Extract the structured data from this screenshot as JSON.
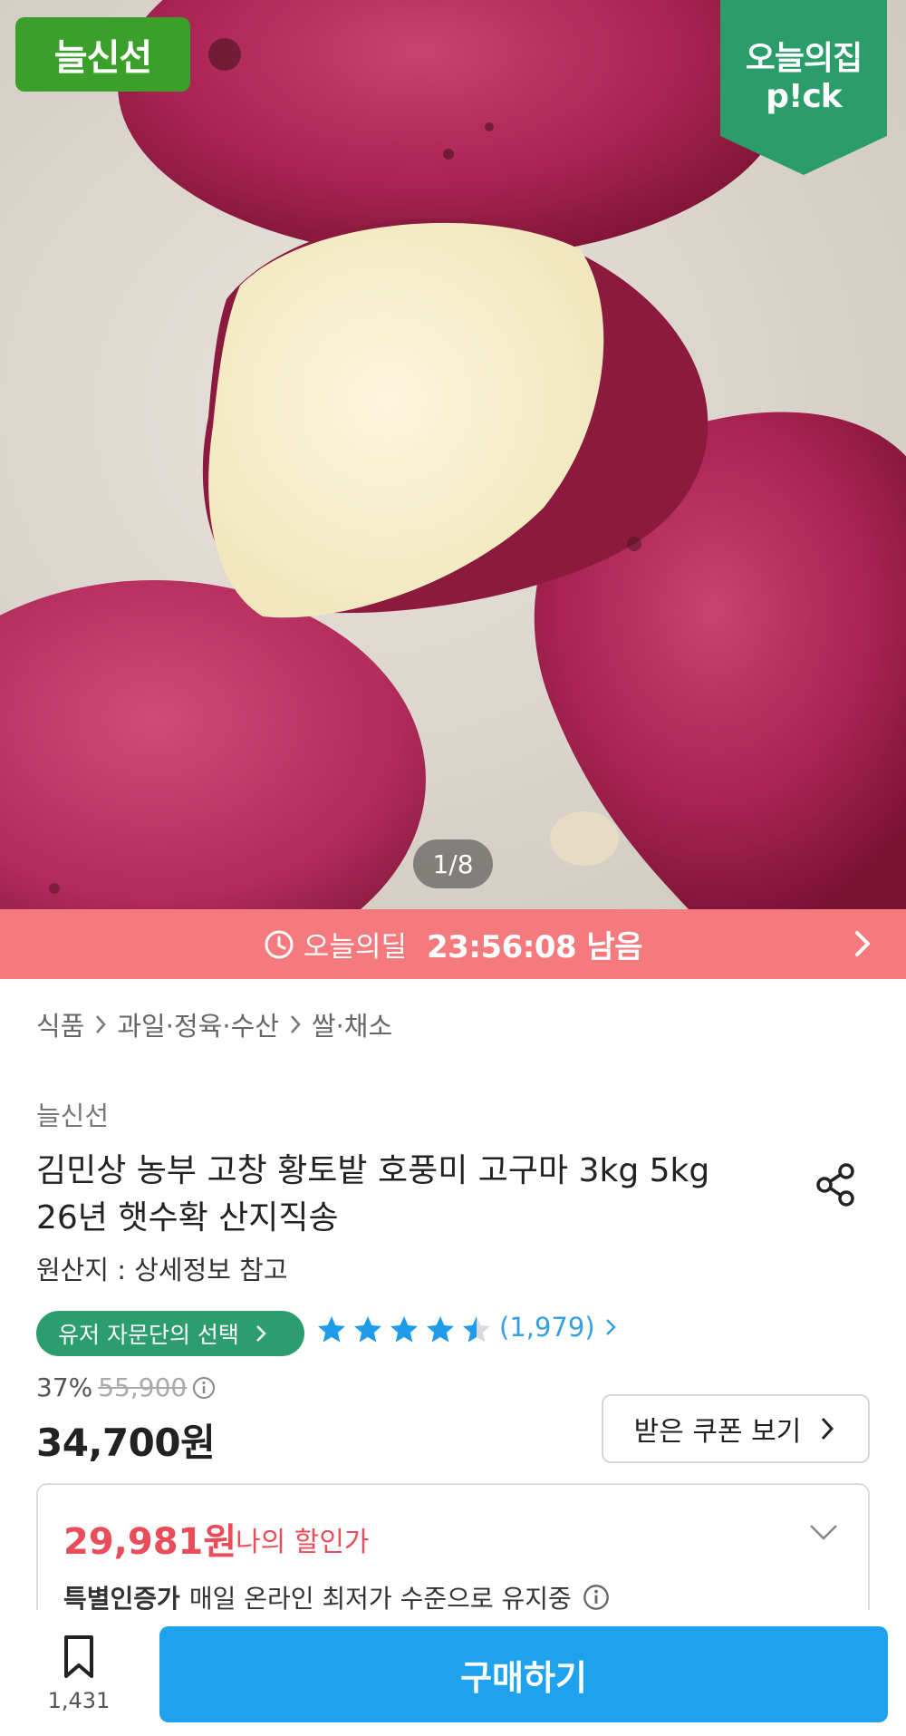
{
  "product_image": {
    "brand_badge": "늘신선",
    "pick_badge_line1": "오늘의집",
    "pick_badge_line2": "p!ck",
    "pager": "1/8"
  },
  "deal": {
    "label": "오늘의딜",
    "countdown": "23:56:08 남음"
  },
  "breadcrumb": [
    "식품",
    "과일·정육·수산",
    "쌀·채소"
  ],
  "product": {
    "seller": "늘신선",
    "title_line1": "김민상 농부 고창 황토밭 호풍미 고구마 3kg 5kg",
    "title_line2": "26년 햇수확 산지직송",
    "origin": "원산지 : 상세정보 참고",
    "user_pick_label": "유저 자문단의 선택",
    "rating_stars": 4.5,
    "review_count": "(1,979)"
  },
  "price": {
    "discount": "37%",
    "original": "55,900",
    "sale": "34,700원",
    "coupon_button": "받은 쿠폰 보기"
  },
  "my_price": {
    "amount": "29,981원",
    "label": "나의 할인가",
    "badge": "특별인증가",
    "description": "매일 온라인 최저가 수준으로 유지중"
  },
  "bottom_bar": {
    "bookmark_count": "1,431",
    "buy_button": "구매하기"
  },
  "colors": {
    "deal_bar": "#f47a7d",
    "brand_green": "#3aa02a",
    "pick_green": "#2a9d6a",
    "star_blue": "#1e9be9",
    "my_price_red": "#e94d5a",
    "buy_blue": "#1ea2ee"
  }
}
